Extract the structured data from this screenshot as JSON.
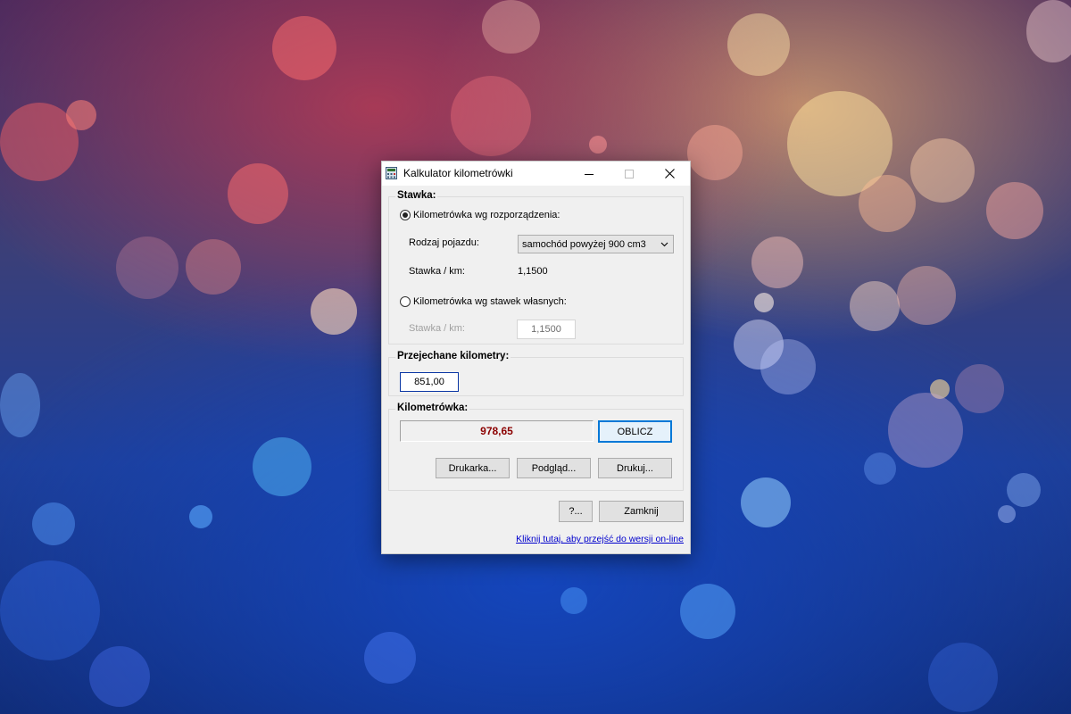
{
  "window": {
    "title": "Kalkulator kilometrówki"
  },
  "stawka": {
    "label": "Stawka:",
    "option_regulation": "Kilometrówka wg rozporządzenia:",
    "vehicle_label": "Rodzaj pojazdu:",
    "vehicle_selected": "samochód powyżej 900 cm3",
    "rate_label": "Stawka / km:",
    "rate_value": "1,1500",
    "option_custom": "Kilometrówka wg stawek własnych:",
    "custom_rate_label": "Stawka / km:",
    "custom_rate_value": "1,1500"
  },
  "distance": {
    "label": "Przejechane kilometry:",
    "value": "851,00"
  },
  "result": {
    "label": "Kilometrówka:",
    "value": "978,65",
    "calc_button": "OBLICZ",
    "printer_button": "Drukarka...",
    "preview_button": "Podgląd...",
    "print_button": "Drukuj..."
  },
  "footer": {
    "help_button": "?...",
    "close_button": "Zamknij",
    "online_link": "Kliknij tutaj, aby przejść do wersji on-line"
  },
  "colors": {
    "result_text": "#8b0000",
    "default_button_border": "#0078d7",
    "link": "#0000cc"
  }
}
